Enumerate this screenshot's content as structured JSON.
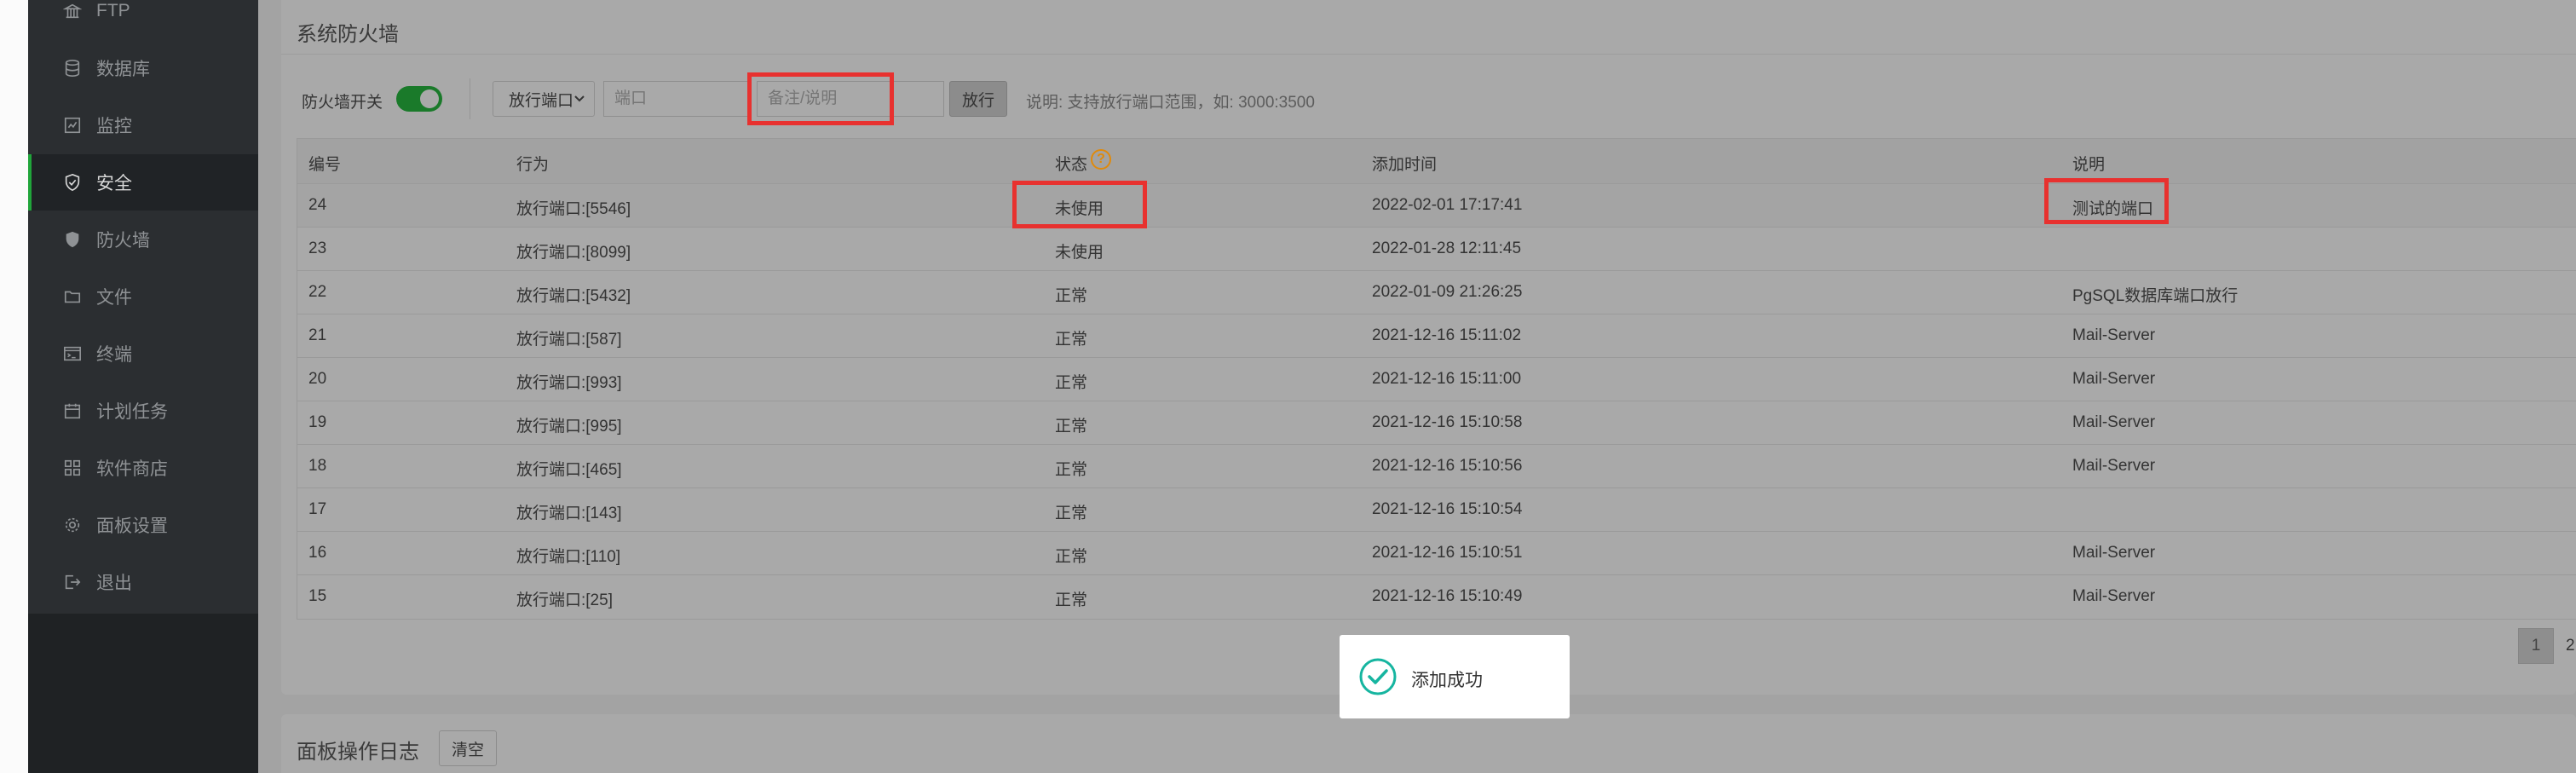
{
  "sidebar": {
    "items": [
      {
        "label": "FTP",
        "icon": "ftp-icon"
      },
      {
        "label": "数据库",
        "icon": "database-icon"
      },
      {
        "label": "监控",
        "icon": "monitor-icon"
      },
      {
        "label": "安全",
        "icon": "shield-icon",
        "active": true
      },
      {
        "label": "防火墙",
        "icon": "firewall-icon"
      },
      {
        "label": "文件",
        "icon": "folder-icon"
      },
      {
        "label": "终端",
        "icon": "terminal-icon"
      },
      {
        "label": "计划任务",
        "icon": "calendar-icon"
      },
      {
        "label": "软件商店",
        "icon": "apps-grid-icon"
      },
      {
        "label": "面板设置",
        "icon": "gear-icon"
      },
      {
        "label": "退出",
        "icon": "logout-icon"
      }
    ]
  },
  "firewall": {
    "title": "系统防火墙",
    "switch_label": "防火墙开关",
    "switch_on": true,
    "select_value": "放行端口",
    "port_placeholder": "端口",
    "remark_placeholder": "备注/说明",
    "allow_button": "放行",
    "hint": "说明: 支持放行端口范围，如: 3000:3500"
  },
  "table": {
    "headers": [
      "编号",
      "行为",
      "状态",
      "添加时间",
      "说明"
    ],
    "rows": [
      [
        "24",
        "放行端口:[5546]",
        "未使用",
        "2022-02-01 17:17:41",
        "测试的端口"
      ],
      [
        "23",
        "放行端口:[8099]",
        "未使用",
        "2022-01-28 12:11:45",
        ""
      ],
      [
        "22",
        "放行端口:[5432]",
        "正常",
        "2022-01-09 21:26:25",
        "PgSQL数据库端口放行"
      ],
      [
        "21",
        "放行端口:[587]",
        "正常",
        "2021-12-16 15:11:02",
        "Mail-Server"
      ],
      [
        "20",
        "放行端口:[993]",
        "正常",
        "2021-12-16 15:11:00",
        "Mail-Server"
      ],
      [
        "19",
        "放行端口:[995]",
        "正常",
        "2021-12-16 15:10:58",
        "Mail-Server"
      ],
      [
        "18",
        "放行端口:[465]",
        "正常",
        "2021-12-16 15:10:56",
        "Mail-Server"
      ],
      [
        "17",
        "放行端口:[143]",
        "正常",
        "2021-12-16 15:10:54",
        ""
      ],
      [
        "16",
        "放行端口:[110]",
        "正常",
        "2021-12-16 15:10:51",
        "Mail-Server"
      ],
      [
        "15",
        "放行端口:[25]",
        "正常",
        "2021-12-16 15:10:49",
        "Mail-Server"
      ]
    ]
  },
  "pagination": {
    "current": "1",
    "next": "2"
  },
  "toast": {
    "message": "添加成功"
  },
  "log": {
    "title": "面板操作日志",
    "clear_button": "清空"
  },
  "colors": {
    "accent": "#20a53a",
    "highlight": "#e8312f",
    "help": "#e08a0b"
  }
}
